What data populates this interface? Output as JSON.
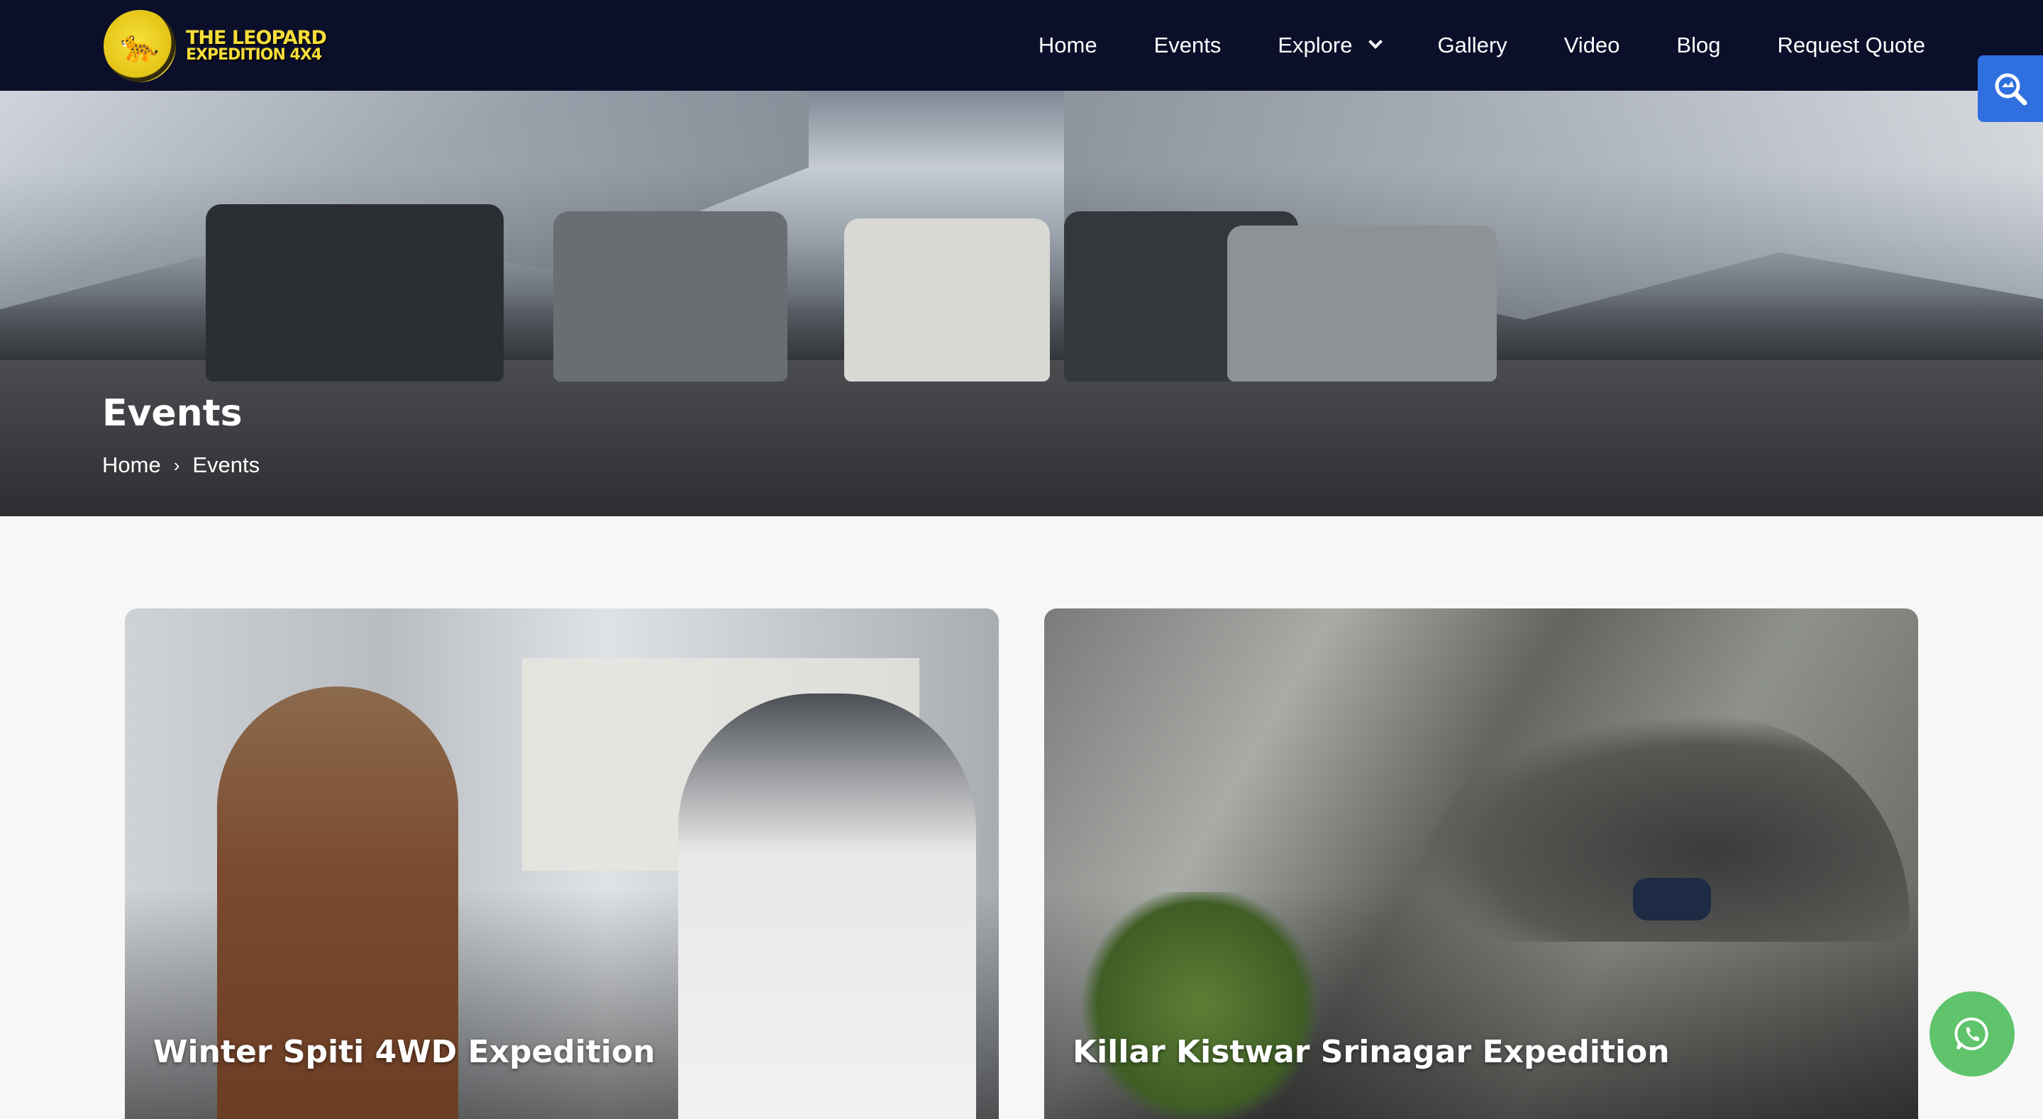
{
  "brand": {
    "line1": "THE LEOPARD",
    "line2": "EXPEDITION 4X4"
  },
  "nav": {
    "items": [
      {
        "label": "Home"
      },
      {
        "label": "Events"
      },
      {
        "label": "Explore"
      },
      {
        "label": "Gallery"
      },
      {
        "label": "Video"
      },
      {
        "label": "Blog"
      },
      {
        "label": "Request Quote"
      }
    ]
  },
  "hero": {
    "title": "Events",
    "breadcrumb": {
      "home": "Home",
      "separator": "›",
      "current": "Events"
    }
  },
  "cards": [
    {
      "title": "Winter Spiti 4WD Expedition"
    },
    {
      "title": "Killar Kistwar Srinagar Expedition"
    }
  ],
  "colors": {
    "navbar": "#0c0f2a",
    "search_fab": "#2f6fe0",
    "whatsapp": "#5fc46b",
    "logo_yellow": "#f6dd3a"
  },
  "icons": {
    "search": "search-zoom-icon",
    "whatsapp": "whatsapp-icon",
    "explore_dropdown": "chevron-down-icon"
  }
}
